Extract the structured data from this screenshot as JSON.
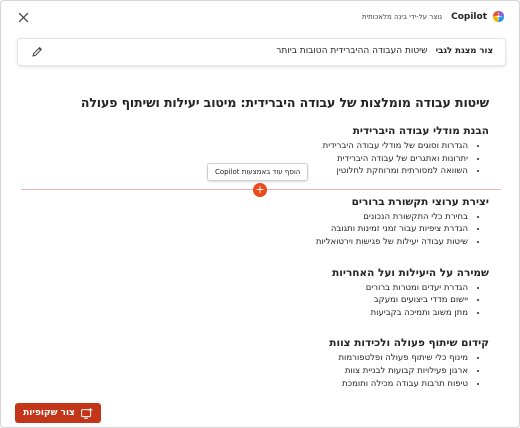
{
  "header": {
    "close_icon": "close-icon",
    "brand": "Copilot",
    "subtitle": "נוצר על-ידי בינה מלאכותית",
    "brand_colors": [
      "#e8553b",
      "#8d5fd3",
      "#1a9ae0",
      "#f5b400"
    ]
  },
  "prompt": {
    "label": "צור מצגת לגבי",
    "text": "שיטות העבודה ההיברידית הטובות ביותר",
    "edit_icon": "pencil-icon"
  },
  "document": {
    "title": "שיטות עבודה מומלצות של עבודה היברידית: מיטוב יעילות ושיתוף פעולה",
    "sections": [
      {
        "heading": "הבנת מודלי עבודה היברידית",
        "bullets": [
          "הגדרות וסוגים של מודלי עבודה היברידית",
          "יתרונות ואתגרים של עבודה היברידית",
          "השוואה למסורתית ומרוחקת לחלוטין"
        ]
      },
      {
        "heading": "יצירת ערוצי תקשורת ברורים",
        "bullets": [
          "בחירת כלי התקשורת הנכונים",
          "הגדרת ציפיות עבור זמני זמינות ותגובה",
          "שיטות עבודה יעילות של פגישות וירטואליות"
        ]
      },
      {
        "heading": "שמירה על היעילות ועל האחריות",
        "bullets": [
          "הגדרת יעדים ומטרות ברורים",
          "יישום מדדי ביצועים ומעקב",
          "מתן משוב ותמיכה בקביעות"
        ]
      },
      {
        "heading": "קידום שיתוף פעולה ולכידות צוות",
        "bullets": [
          "מינוף כלי שיתוף פעולה ופלטפורמות",
          "ארגון פעילויות קבועות לבניית צוות",
          "טיפוח תרבות עבודה מכילה ותומכת"
        ]
      }
    ]
  },
  "insert": {
    "tooltip": "הוסף עוד באמצעות Copilot",
    "button_glyph": "+",
    "accent": "#ea4a1c"
  },
  "footer": {
    "create_slides_label": "צור שקופיות",
    "create_slides_icon": "slides-add-icon",
    "button_color": "#c4361a"
  }
}
